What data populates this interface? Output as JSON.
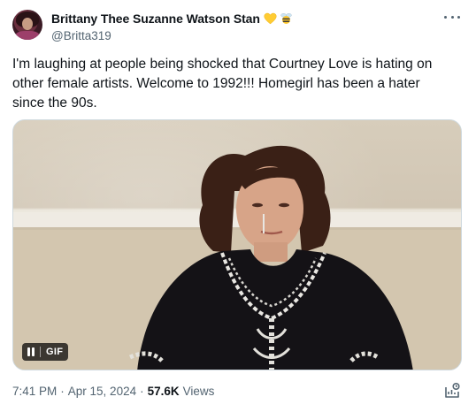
{
  "author": {
    "display_name": "Brittany Thee Suzanne Watson Stan",
    "handle": "@Britta319",
    "badges": [
      "yellow-heart-emoji",
      "bee-emoji"
    ]
  },
  "tweet": {
    "text": "I'm laughing at people being shocked that Courtney Love is hating on other female artists. Welcome to 1992!!! Homegirl has been a hater since the 90s."
  },
  "media": {
    "badge_label": "GIF",
    "controls_icon": "pause-icon"
  },
  "meta": {
    "time": "7:41 PM",
    "separator": "·",
    "date": "Apr 15, 2024",
    "views_count": "57.6K",
    "views_label": "Views"
  },
  "icons": {
    "more": "more-icon",
    "analytics": "analytics-icon"
  },
  "colors": {
    "text_primary": "#0f1419",
    "text_secondary": "#536471",
    "border": "#cfd9de"
  }
}
